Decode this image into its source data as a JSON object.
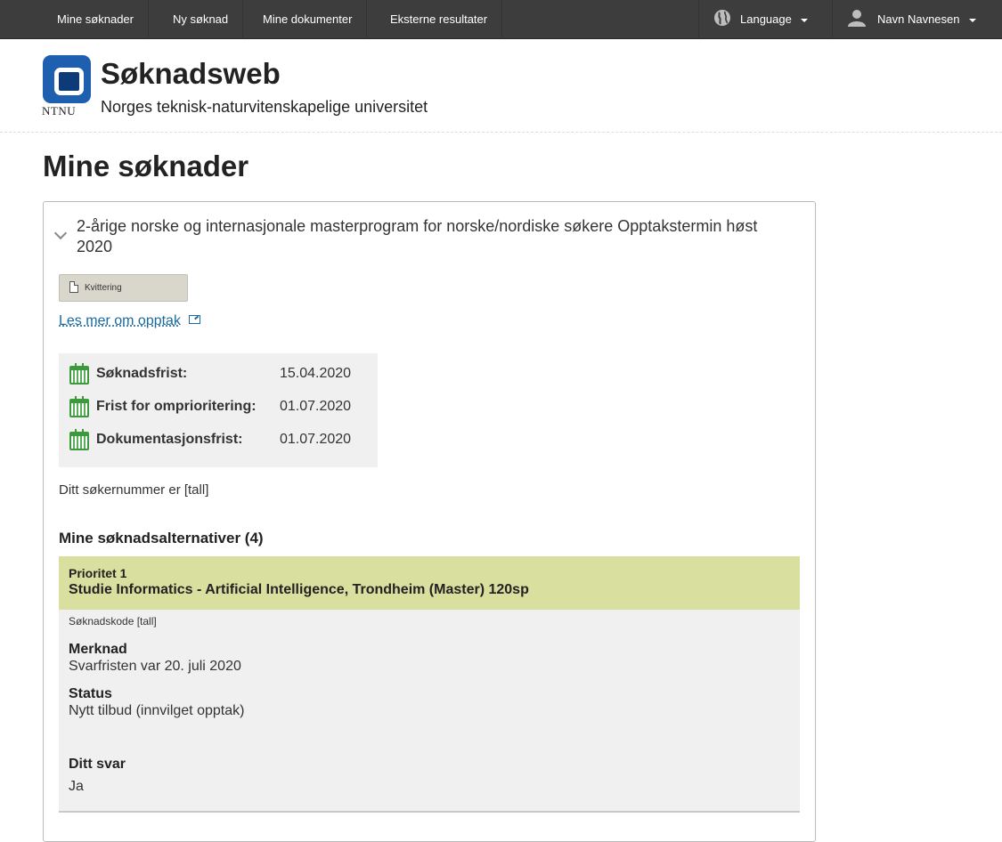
{
  "nav": {
    "items": [
      "Mine søknader",
      "Ny søknad",
      "Mine dokumenter",
      "Eksterne resultater"
    ],
    "language_label": "Language",
    "user_name": "Navn Navnesen"
  },
  "header": {
    "logo_text": "NTNU",
    "title": "Søknadsweb",
    "subtitle": "Norges teknisk-naturvitenskapelige universitet"
  },
  "page": {
    "title": "Mine søknader"
  },
  "application": {
    "heading": "2-årige norske og internasjonale masterprogram for norske/nordiske søkere Opptakstermin høst 2020",
    "receipt_label": "Kvittering",
    "read_more": "Les mer om opptak",
    "dates": [
      {
        "label": "Søknadsfrist:",
        "value": "15.04.2020"
      },
      {
        "label": "Frist for omprioritering:",
        "value": "01.07.2020"
      },
      {
        "label": "Dokumentasjonsfrist:",
        "value": "01.07.2020"
      }
    ],
    "applicant_number_text": "Ditt søkernummer er [tall]",
    "alternatives_heading": "Mine søknadsalternativer (4)",
    "alternatives": [
      {
        "priority": "Prioritet 1",
        "program": "Studie Informatics - Artificial Intelligence, Trondheim (Master) 120sp",
        "code_text": "Søknadskode [tall]",
        "note_label": "Merknad",
        "note_value": "Svarfristen var 20. juli 2020",
        "status_label": "Status",
        "status_value": "Nytt tilbud (innvilget opptak)",
        "answer_label": "Ditt svar",
        "answer_value": "Ja"
      }
    ]
  },
  "icons": {
    "globe": "globe-icon",
    "user": "user-icon",
    "document": "document-icon",
    "external_link": "external-link-icon",
    "calendar": "calendar-icon",
    "chevron": "chevron-down-icon"
  },
  "colors": {
    "navbar": "#3d3d3d",
    "logo_blue": "#1f5fb0",
    "link": "#1a6aa0",
    "alternative_header": "#d9df9e",
    "calendar_green": "#3c9a3c"
  }
}
